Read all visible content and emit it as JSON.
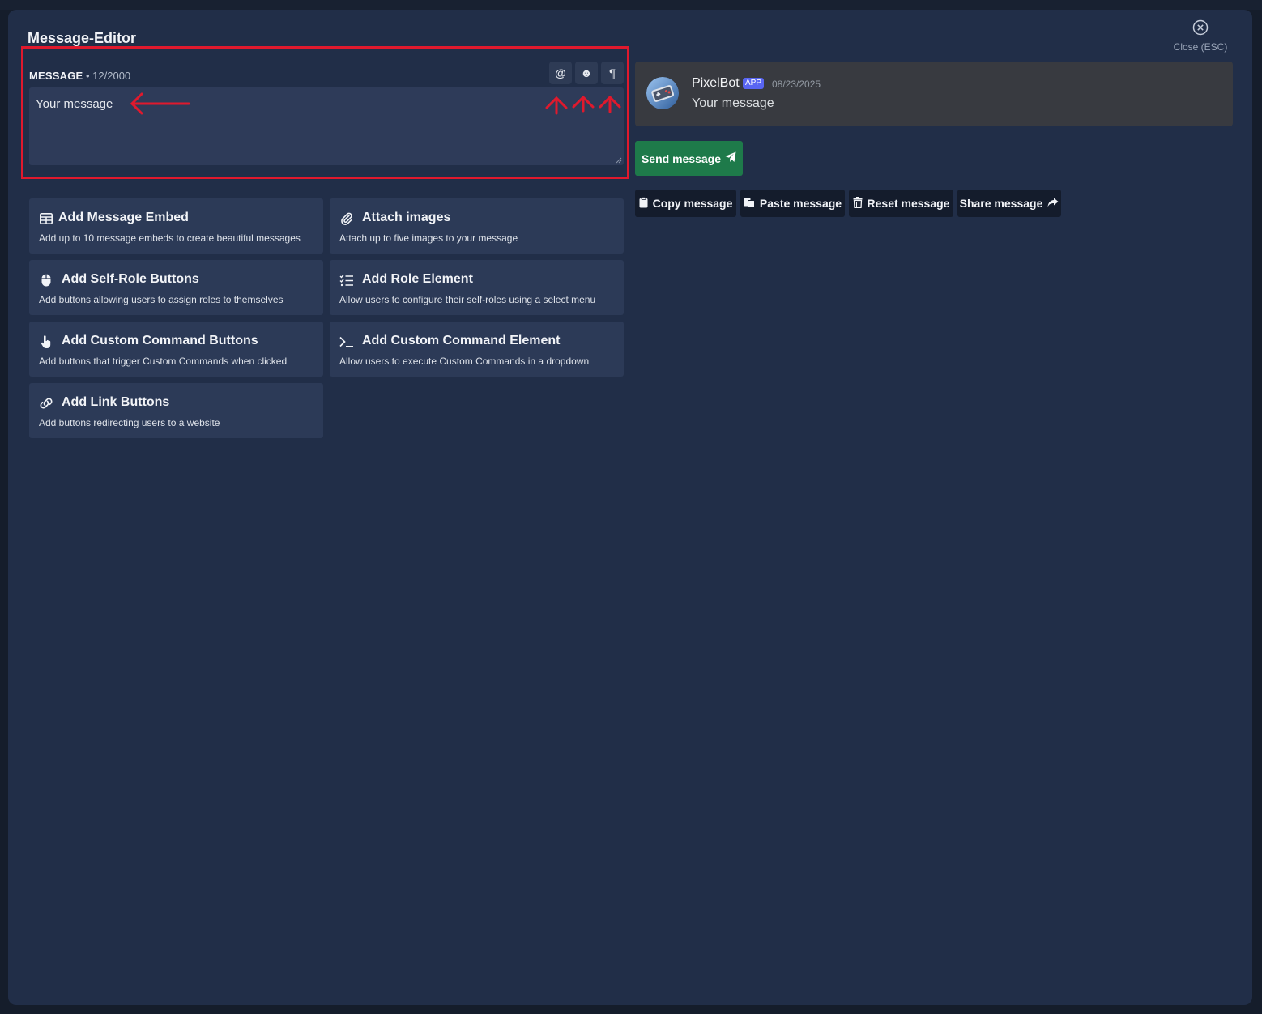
{
  "modal": {
    "title": "Message-Editor",
    "close_label": "Close (ESC)"
  },
  "message": {
    "label": "MESSAGE",
    "count": "• 12/2000",
    "value": "Your message",
    "tools": [
      {
        "icon": "at-sign-icon",
        "glyph": "@"
      },
      {
        "icon": "emoji-icon",
        "glyph": "☻"
      },
      {
        "icon": "pilcrow-icon",
        "glyph": "¶"
      }
    ]
  },
  "cards": [
    {
      "icon": "table-icon",
      "title": "Add Message Embed",
      "desc": "Add up to 10 message embeds to create beautiful messages"
    },
    {
      "icon": "paperclip-icon",
      "title": "Attach images",
      "desc": "Attach up to five images to your message"
    },
    {
      "icon": "mouse-icon",
      "title": "Add Self-Role Buttons",
      "desc": "Add buttons allowing users to assign roles to themselves"
    },
    {
      "icon": "list-check-icon",
      "title": "Add Role Element",
      "desc": "Allow users to configure their self-roles using a select menu"
    },
    {
      "icon": "pointer-hand-icon",
      "title": "Add Custom Command Buttons",
      "desc": "Add buttons that trigger Custom Commands when clicked"
    },
    {
      "icon": "terminal-icon",
      "title": "Add Custom Command Element",
      "desc": "Allow users to execute Custom Commands in a dropdown"
    },
    {
      "icon": "link-icon",
      "title": "Add Link Buttons",
      "desc": "Add buttons redirecting users to a website"
    }
  ],
  "preview": {
    "bot_name": "PixelBot",
    "badge": "APP",
    "date": "08/23/2025",
    "text": "Your message"
  },
  "actions": {
    "send": "Send message",
    "copy": "Copy message",
    "paste": "Paste message",
    "reset": "Reset message",
    "share": "Share message"
  },
  "colors": {
    "modal_bg": "#212e48",
    "card_bg": "#2c3a57",
    "send_green": "#1e7a4a",
    "annotation_red": "#e0192d",
    "app_badge": "#5865f2"
  }
}
